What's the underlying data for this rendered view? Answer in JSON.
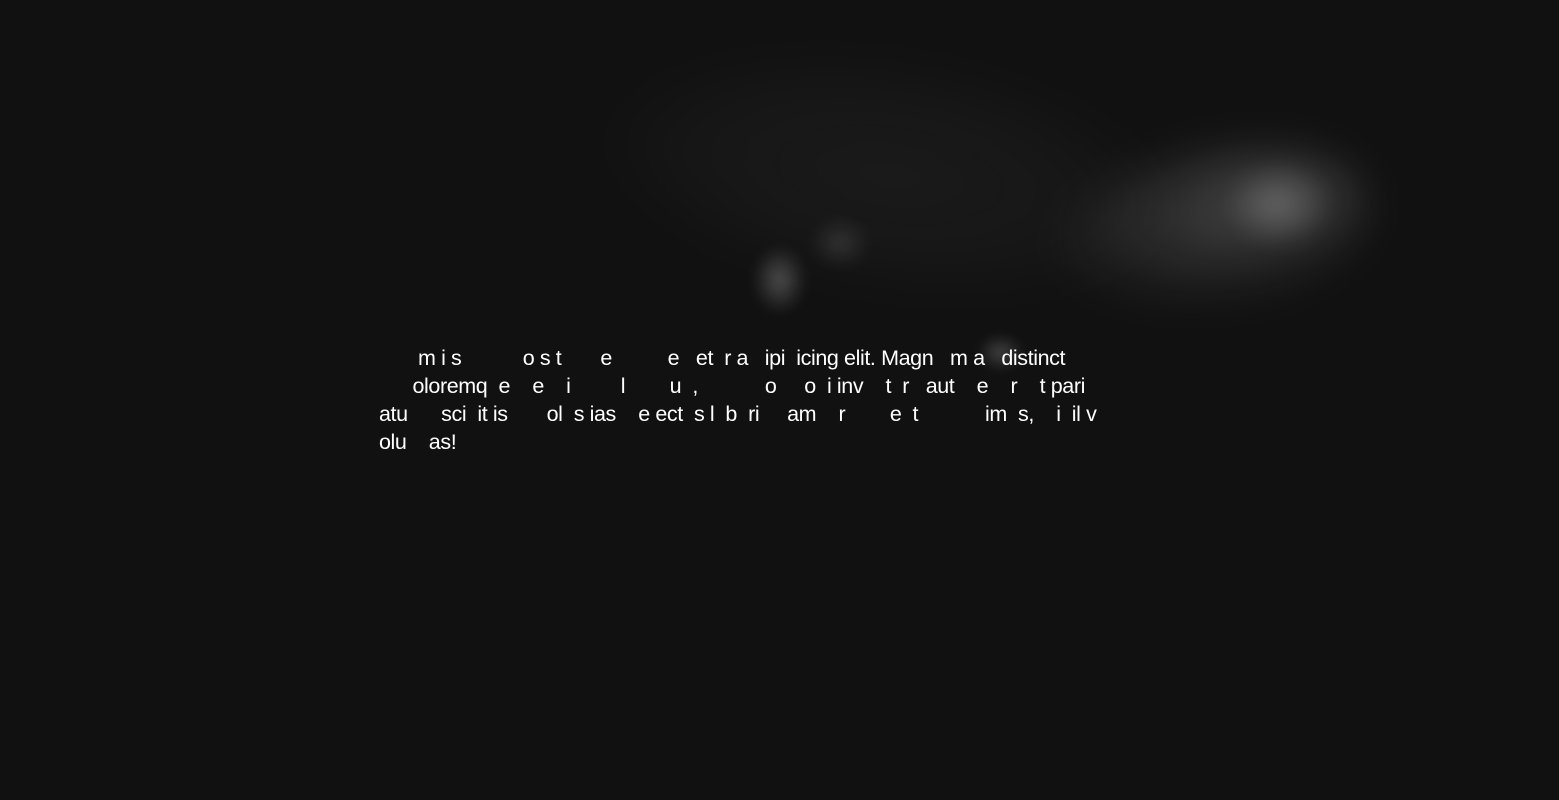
{
  "main": {
    "paragraph": "       m i s           o s t       e          e   et  r a   ipi  icing elit. Magn   m a   distinct\n      oloremq  e    e    i         l        u  ,            o     o  i inv    t  r   aut    e    r    t pari\natu      sci  it is       ol  s ias    e ect  s l  b  ri     am    r        e  t            im  s,    i  il v\nolu    as!"
  }
}
